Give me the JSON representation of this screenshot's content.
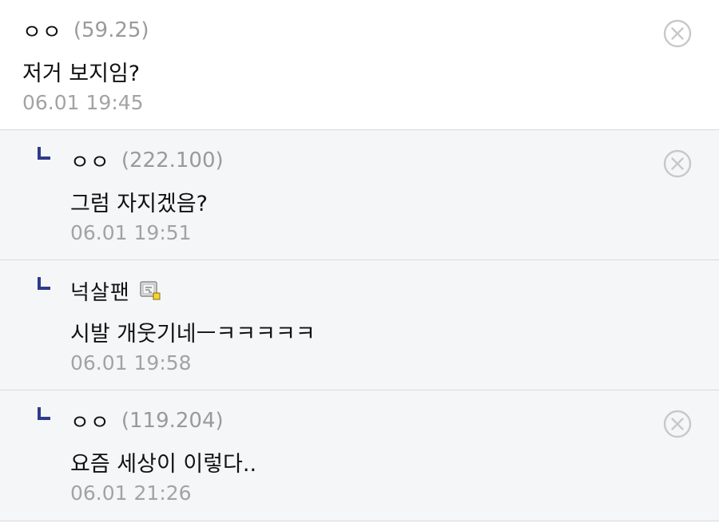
{
  "comments": [
    {
      "nick": "ㅇㅇ",
      "ip": "(59.25)",
      "text": "저거 보지임?",
      "time": "06.01 19:45",
      "deletable": true
    },
    {
      "nick": "ㅇㅇ",
      "ip": "(222.100)",
      "text": "그럼 자지겠음?",
      "time": "06.01 19:51",
      "deletable": true
    },
    {
      "nick": "넉살팬",
      "ip": "",
      "text": "시발 개웃기네ㅡㅋㅋㅋㅋㅋ",
      "time": "06.01 19:58",
      "deletable": false,
      "badge_icon": "fixed-nick-badge-icon"
    },
    {
      "nick": "ㅇㅇ",
      "ip": "(119.204)",
      "text": "요즘 세상이 이렇다..",
      "time": "06.01 21:26",
      "deletable": true
    }
  ],
  "colors": {
    "reply_mark": "#2f3b8a",
    "reply_background": "#f5f6f8",
    "meta_text": "#9a9a9a",
    "divider": "#d9d9d9"
  }
}
